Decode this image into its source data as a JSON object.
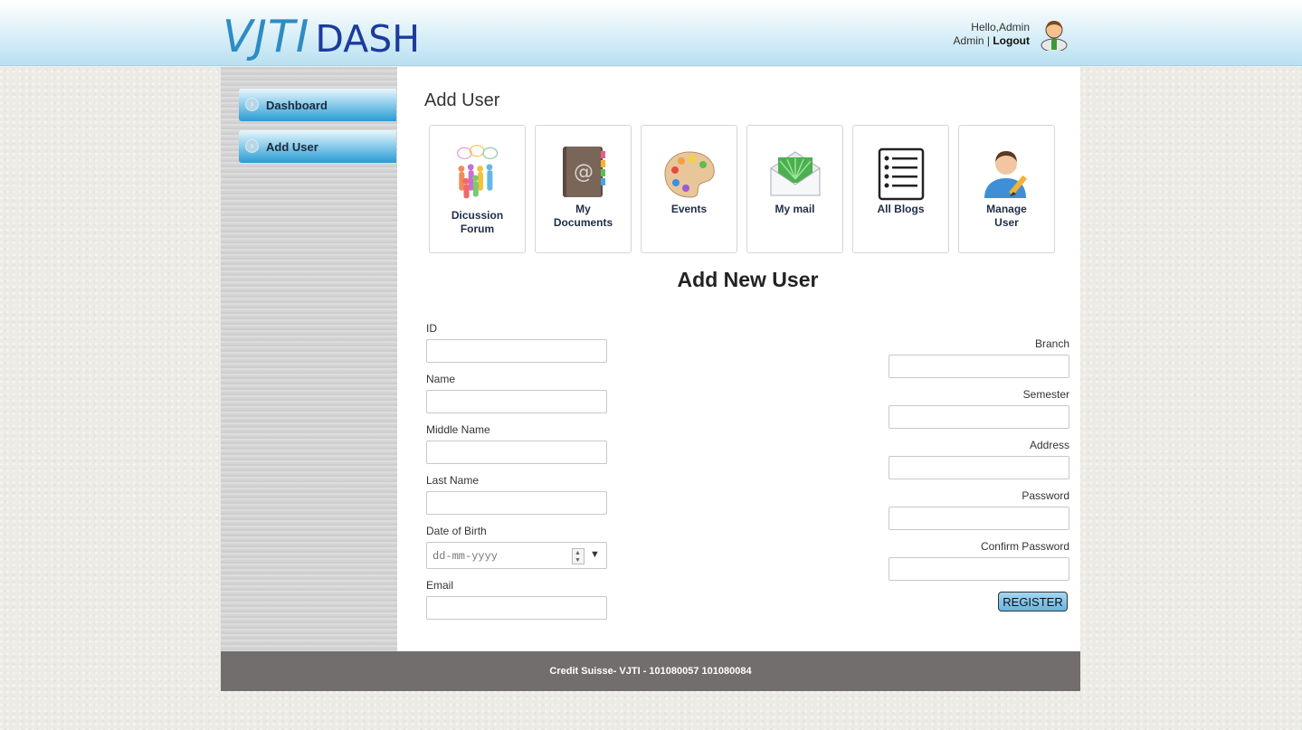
{
  "header": {
    "logo_vjti": "VJTI",
    "logo_dash": "DASH",
    "greeting": "Hello,Admin",
    "role": "Admin",
    "separator": "|",
    "logout": "Logout"
  },
  "sidebar": {
    "items": [
      {
        "label": "Dashboard",
        "icon": "chevron-right-icon"
      },
      {
        "label": "Add User",
        "icon": "chevron-right-icon"
      }
    ]
  },
  "main": {
    "page_title": "Add User",
    "tiles": [
      {
        "line1": "Dicussion",
        "line2": "Forum",
        "icon": "discussion-forum-icon"
      },
      {
        "line1": "My",
        "line2": "Documents",
        "icon": "address-book-icon"
      },
      {
        "line1": "Events",
        "line2": "",
        "icon": "palette-icon"
      },
      {
        "line1": "My mail",
        "line2": "",
        "icon": "mail-envelope-icon"
      },
      {
        "line1": "All Blogs",
        "line2": "",
        "icon": "list-icon"
      },
      {
        "line1": "Manage",
        "line2": "User",
        "icon": "user-edit-icon"
      }
    ],
    "form": {
      "heading": "Add New User",
      "left_fields": {
        "id": "ID",
        "name": "Name",
        "middle_name": "Middle Name",
        "last_name": "Last Name",
        "dob": "Date of Birth",
        "dob_placeholder": "dd-mm-yyyy",
        "email": "Email"
      },
      "right_fields": {
        "branch": "Branch",
        "semester": "Semester",
        "address": "Address",
        "password": "Password",
        "confirm_password": "Confirm Password"
      },
      "register_label": "REGISTER"
    }
  },
  "footer": {
    "text": "Credit Suisse- VJTI - 101080057 101080084"
  },
  "colors": {
    "header_gradient_bottom": "#b9e0f1",
    "logo_vjti": "#2f8cc3",
    "logo_dash": "#1b3c9c",
    "nav_blue": "#2a9bd5",
    "footer_bg": "#726e6d"
  }
}
